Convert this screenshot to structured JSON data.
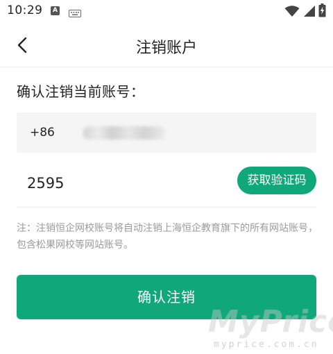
{
  "status_bar": {
    "time": "10:29",
    "icons": [
      "a-notification-icon",
      "keyboard-icon",
      "wifi-icon",
      "cell-signal-icon",
      "battery-charging-icon"
    ]
  },
  "nav": {
    "title": "注销账户",
    "back_icon": "chevron-left-icon"
  },
  "form": {
    "section_label": "确认注销当前账号：",
    "phone_prefix": "+86",
    "phone_number_redacted": true,
    "code_value": "2595",
    "get_code_label": "获取验证码"
  },
  "note": "注：注销恒企网校账号将自动注销上海恒企教育旗下的所有网站账号，包含松果网校等网站账号。",
  "confirm_label": "确认注销",
  "watermark": {
    "logo": "MyPrice",
    "url": "myprice.com.cn"
  },
  "colors": {
    "accent": "#10a87a",
    "phone_bg": "#f5f5f5",
    "note_text": "#9a9a9a"
  }
}
